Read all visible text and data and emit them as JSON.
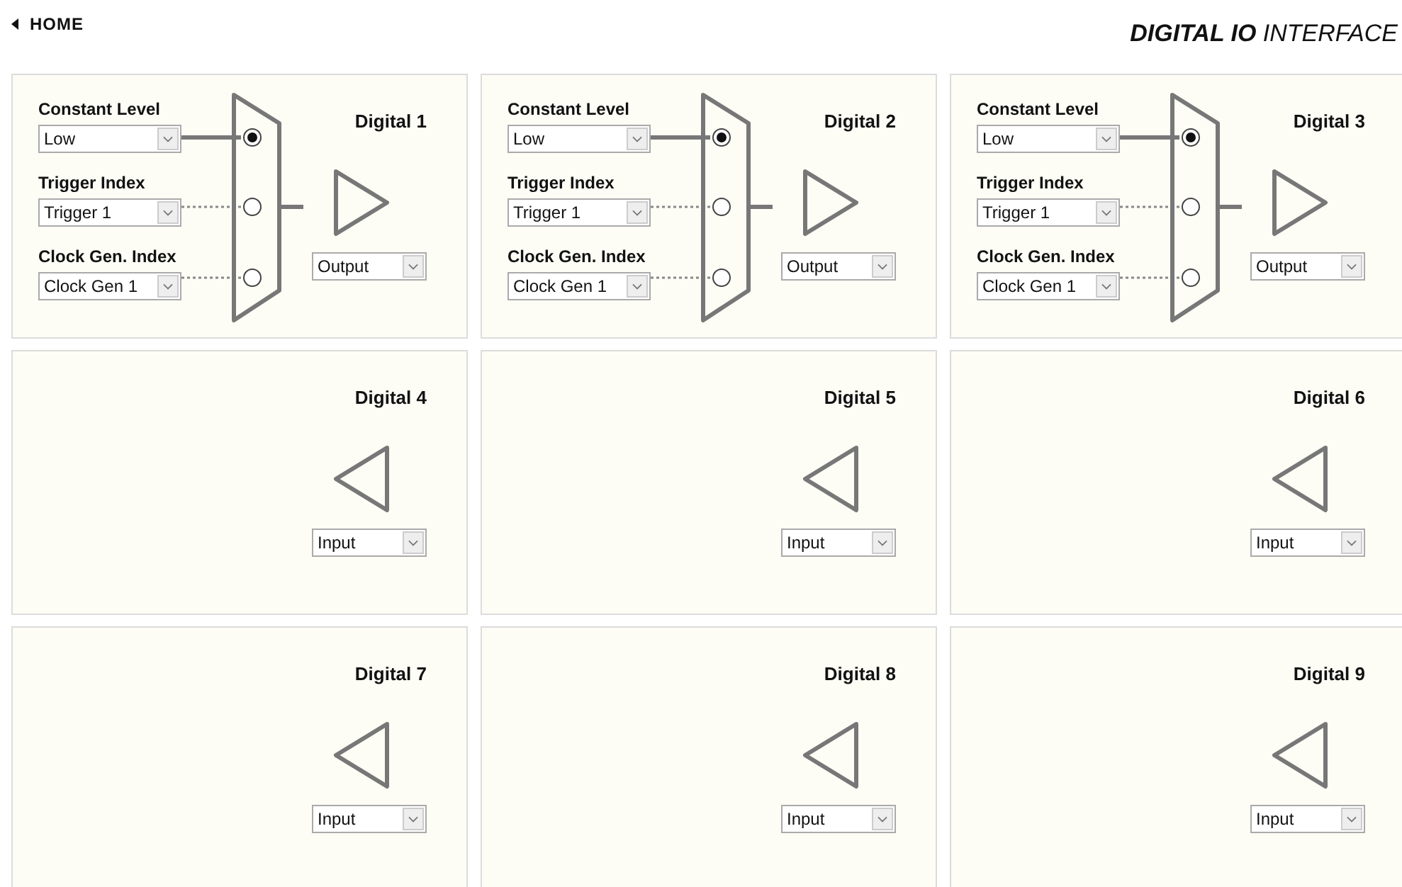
{
  "header": {
    "home_link": "HOME",
    "title": "**DIGITAL IO** INTERFACE"
  },
  "panels": [
    {
      "kind": "output",
      "title": "Digital 1",
      "direction": "Output",
      "sources": [
        {
          "label": "Constant Level",
          "value": "Low",
          "selected": true
        },
        {
          "label": "Trigger Index",
          "value": "Trigger 1",
          "selected": false
        },
        {
          "label": "Clock Gen. Index",
          "value": "Clock Gen 1",
          "selected": false
        }
      ]
    },
    {
      "kind": "output",
      "title": "Digital 2",
      "direction": "Output",
      "sources": [
        {
          "label": "Constant Level",
          "value": "Low",
          "selected": true
        },
        {
          "label": "Trigger Index",
          "value": "Trigger 1",
          "selected": false
        },
        {
          "label": "Clock Gen. Index",
          "value": "Clock Gen 1",
          "selected": false
        }
      ]
    },
    {
      "kind": "output",
      "title": "Digital 3",
      "direction": "Output",
      "sources": [
        {
          "label": "Constant Level",
          "value": "Low",
          "selected": true
        },
        {
          "label": "Trigger Index",
          "value": "Trigger 1",
          "selected": false
        },
        {
          "label": "Clock Gen. Index",
          "value": "Clock Gen 1",
          "selected": false
        }
      ]
    },
    {
      "kind": "input",
      "title": "Digital 4",
      "direction": "Input"
    },
    {
      "kind": "input",
      "title": "Digital 5",
      "direction": "Input"
    },
    {
      "kind": "input",
      "title": "Digital 6",
      "direction": "Input"
    },
    {
      "kind": "input",
      "title": "Digital 7",
      "direction": "Input"
    },
    {
      "kind": "input",
      "title": "Digital 8",
      "direction": "Input"
    },
    {
      "kind": "input",
      "title": "Digital 9",
      "direction": "Input"
    }
  ]
}
